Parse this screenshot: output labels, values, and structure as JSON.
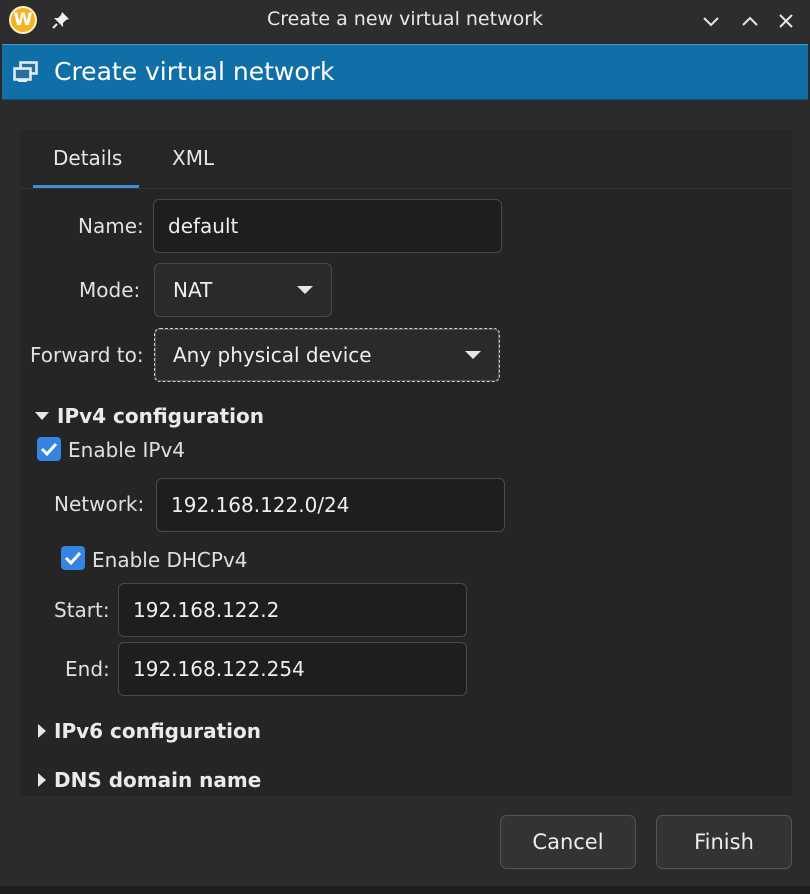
{
  "window": {
    "title": "Create a new virtual network",
    "logo_letter": "W",
    "icons": [
      "pin-icon",
      "minimize-icon",
      "maximize-icon",
      "close-icon"
    ]
  },
  "banner": {
    "title": "Create virtual network",
    "icon": "network-icon"
  },
  "tabs": [
    {
      "label": "Details",
      "active": true
    },
    {
      "label": "XML",
      "active": false
    }
  ],
  "details": {
    "name_label": "Name:",
    "name_value": "default",
    "mode_label": "Mode:",
    "mode_value": "NAT",
    "forward_label": "Forward to:",
    "forward_value": "Any physical device"
  },
  "ipv4": {
    "section_label": "IPv4 configuration",
    "expanded": true,
    "enable_label": "Enable IPv4",
    "enable_checked": true,
    "network_label": "Network:",
    "network_value": "192.168.122.0/24",
    "dhcp_label": "Enable DHCPv4",
    "dhcp_checked": true,
    "start_label": "Start:",
    "start_value": "192.168.122.2",
    "end_label": "End:",
    "end_value": "192.168.122.254"
  },
  "ipv6": {
    "section_label": "IPv6 configuration",
    "expanded": false
  },
  "dns": {
    "section_label": "DNS domain name",
    "expanded": false
  },
  "buttons": {
    "cancel": "Cancel",
    "finish": "Finish"
  },
  "colors": {
    "accent": "#3584e4",
    "banner": "#0f6fa6",
    "background": "#2b2b2b"
  }
}
